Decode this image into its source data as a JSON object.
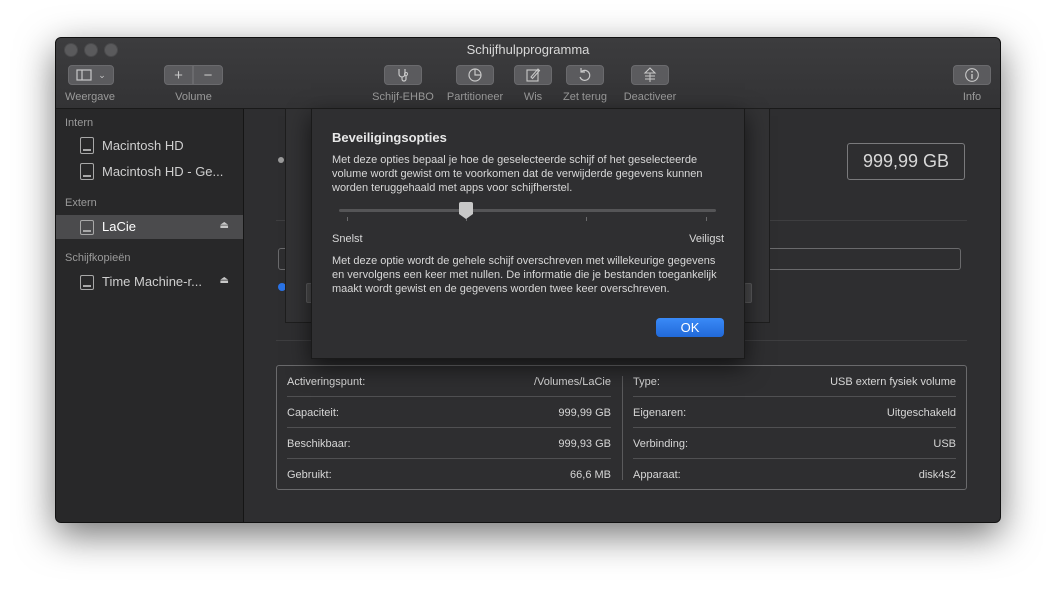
{
  "window": {
    "title": "Schijfhulpprogramma"
  },
  "toolbar": {
    "view_label": "Weergave",
    "volume_label": "Volume",
    "volume_add": "+",
    "volume_remove": "−",
    "first_aid_label": "Schijf-EHBO",
    "partition_label": "Partitioneer",
    "erase_label": "Wis",
    "restore_label": "Zet terug",
    "unmount_label": "Deactiveer",
    "info_label": "Info"
  },
  "sidebar": {
    "sections": [
      {
        "heading": "Intern",
        "items": [
          {
            "label": "Macintosh HD"
          },
          {
            "label": "Macintosh HD - Ge..."
          }
        ]
      },
      {
        "heading": "Extern",
        "items": [
          {
            "label": "LaCie",
            "selected": true,
            "eject": true
          }
        ]
      },
      {
        "heading": "Schijfkopieën",
        "items": [
          {
            "label": "Time Machine-r...",
            "eject": true
          }
        ]
      }
    ]
  },
  "main": {
    "capacity_badge": "999,99 GB",
    "info": {
      "left": [
        {
          "key": "Activeringspunt:",
          "value": "/Volumes/LaCie"
        },
        {
          "key": "Capaciteit:",
          "value": "999,99 GB"
        },
        {
          "key": "Beschikbaar:",
          "value": "999,93 GB"
        },
        {
          "key": "Gebruikt:",
          "value": "66,6 MB"
        }
      ],
      "right": [
        {
          "key": "Type:",
          "value": "USB extern fysiek volume"
        },
        {
          "key": "Eigenaren:",
          "value": "Uitgeschakeld"
        },
        {
          "key": "Verbinding:",
          "value": "USB"
        },
        {
          "key": "Apparaat:",
          "value": "disk4s2"
        }
      ]
    }
  },
  "dialog": {
    "title": "Beveiligingsopties",
    "description": "Met deze opties bepaal je hoe de geselecteerde schijf of het geselecteerde volume wordt gewist om te voorkomen dat de verwijderde gegevens kunnen worden teruggehaald met apps voor schijfherstel.",
    "slider": {
      "min_label": "Snelst",
      "max_label": "Veiligst",
      "position": 1,
      "steps": 4
    },
    "option_text": "Met deze optie wordt de gehele schijf overschreven met willekeurige gegevens en vervolgens een keer met nullen. De informatie die je bestanden toegankelijk maakt wordt gewist en de gegevens worden twee keer overschreven.",
    "ok_label": "OK"
  },
  "colors": {
    "accent": "#2a73e6",
    "window_bg": "#2b2b2d"
  }
}
